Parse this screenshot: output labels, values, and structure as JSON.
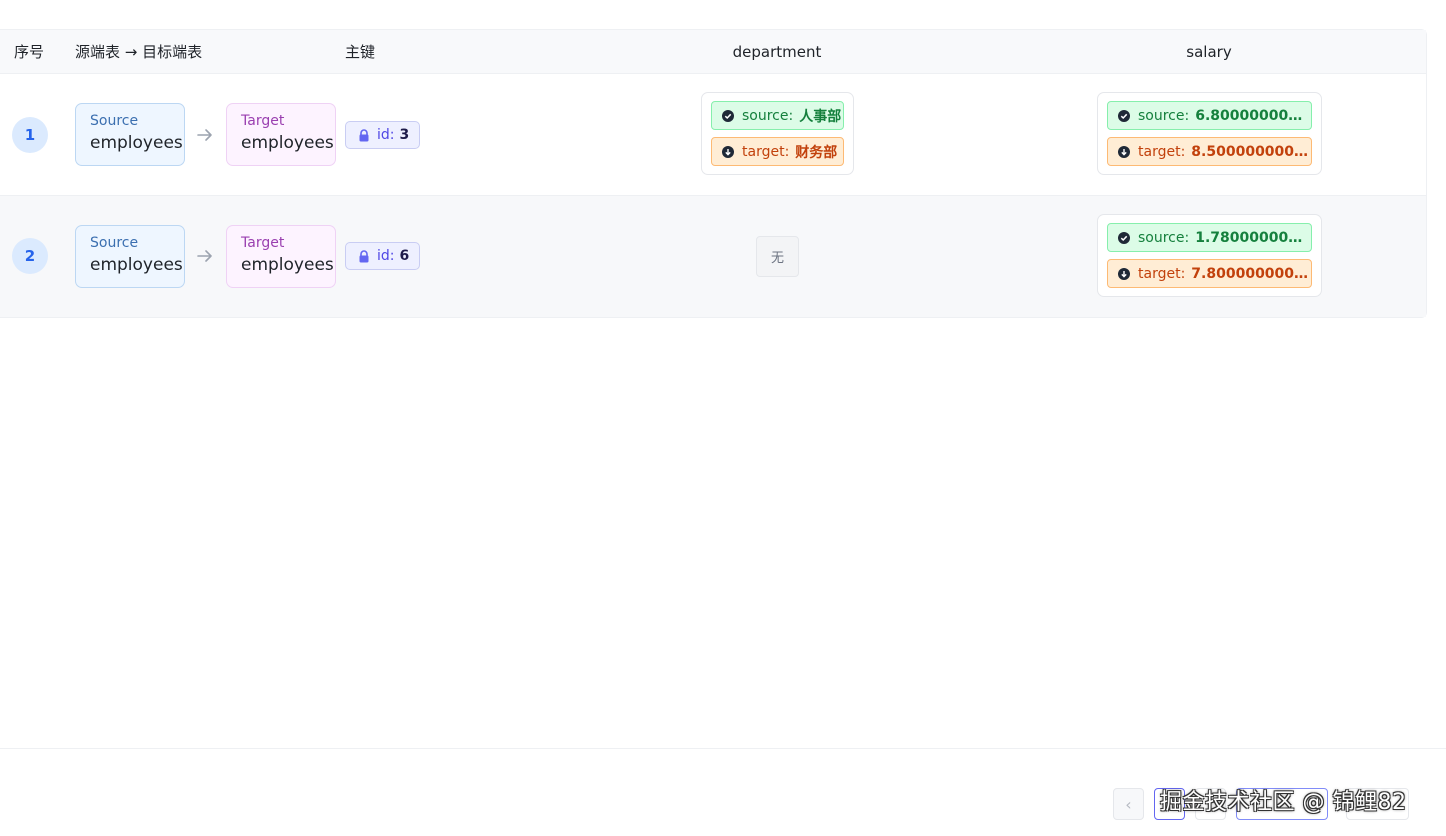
{
  "table": {
    "headers": {
      "index": "序号",
      "mapping": "源端表 → 目标端表",
      "primary_key": "主键",
      "col_department": "department",
      "col_salary": "salary"
    },
    "rows": [
      {
        "index": "1",
        "source_kind": "Source",
        "source_table": "employees",
        "target_kind": "Target",
        "target_table": "employees",
        "pk_label": "id:",
        "pk_value": "3",
        "department": {
          "source_label": "source:",
          "source_value": "人事部",
          "target_label": "target:",
          "target_value": "财务部"
        },
        "salary": {
          "source_label": "source:",
          "source_value": "6.8000000000...",
          "target_label": "target:",
          "target_value": "8.5000000000..."
        }
      },
      {
        "index": "2",
        "source_kind": "Source",
        "source_table": "employees",
        "target_kind": "Target",
        "target_table": "employees",
        "pk_label": "id:",
        "pk_value": "6",
        "department_none": "无",
        "salary": {
          "source_label": "source:",
          "source_value": "1.7800000000...",
          "target_label": "target:",
          "target_value": "7.8000000000..."
        }
      }
    ]
  },
  "pagination": {
    "prev_glyph": "‹"
  },
  "watermark": "掘金技术社区 @ 锦鲤82",
  "colors": {
    "source_green": "#15803d",
    "target_orange": "#c2410c",
    "index_blue": "#2563eb",
    "pk_indigo": "#4f46e5"
  }
}
